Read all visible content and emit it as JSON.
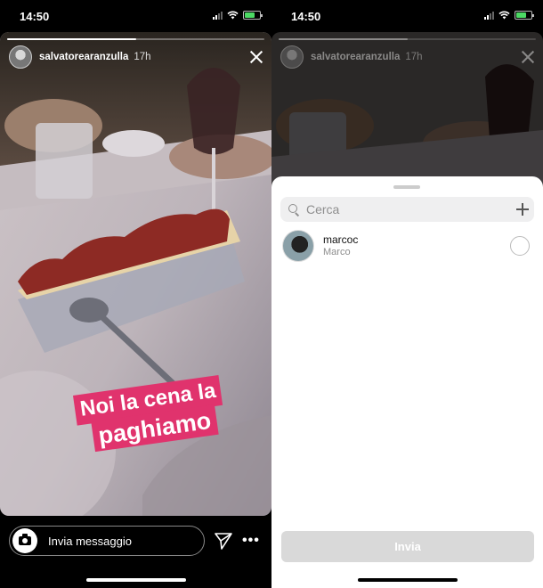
{
  "status_bar": {
    "time": "14:50",
    "battery_level": 0.7
  },
  "story": {
    "username": "salvatorearanzulla",
    "time_ago": "17h",
    "progress": 0.5,
    "caption_line1": "Noi la cena la",
    "caption_line2": "paghiamo",
    "caption_color": "#e0336d"
  },
  "reply_bar": {
    "placeholder": "Invia messaggio",
    "more_label": "•••"
  },
  "share_sheet": {
    "search_placeholder": "Cerca",
    "contacts": [
      {
        "handle": "marcoc",
        "name": "Marco"
      }
    ],
    "send_label": "Invia"
  }
}
